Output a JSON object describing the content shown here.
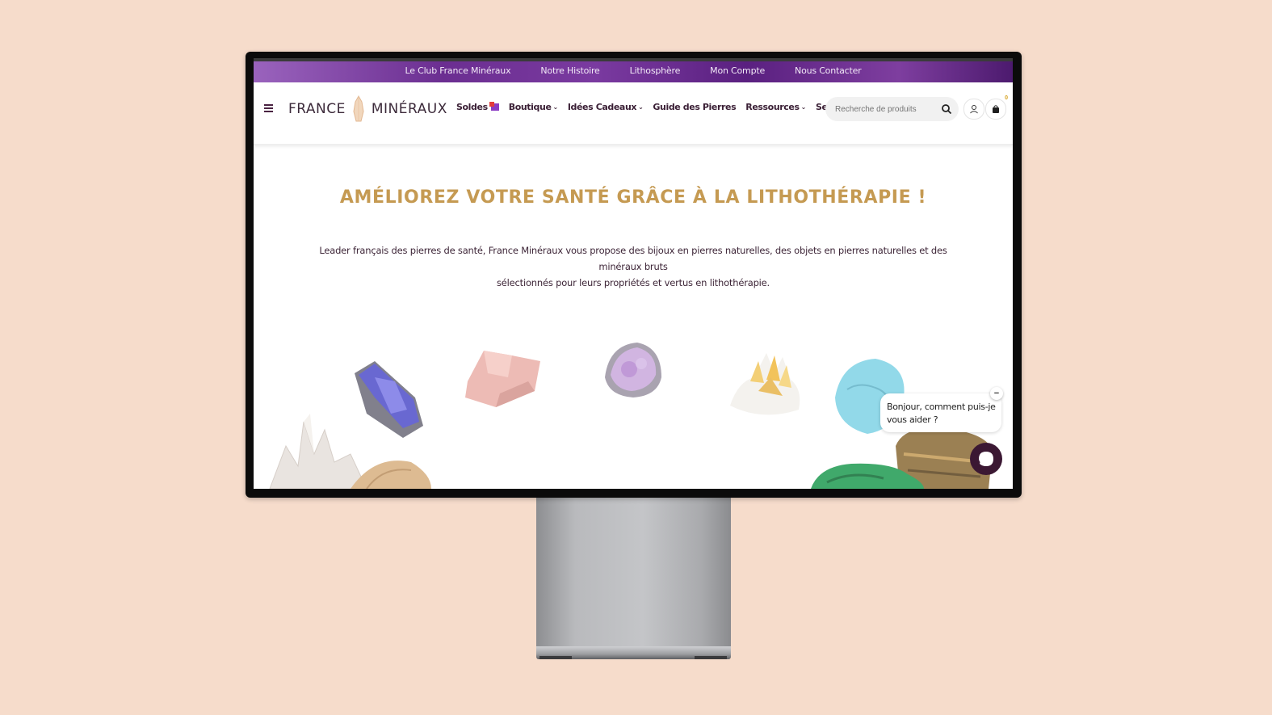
{
  "topbar": {
    "links": [
      "Le Club France Minéraux",
      "Notre Histoire",
      "Lithosphère",
      "Mon Compte",
      "Nous Contacter"
    ]
  },
  "header": {
    "logo_left": "FRANCE",
    "logo_right": "MINÉRAUX",
    "nav": {
      "soldes": "Soldes",
      "boutique": "Boutique",
      "idees": "Idées Cadeaux",
      "guide": "Guide des Pierres",
      "ressources": "Ressources",
      "services": "Services"
    },
    "search_placeholder": "Recherche de produits",
    "cart_count": "0"
  },
  "hero": {
    "title": "AMÉLIOREZ VOTRE SANTÉ GRÂCE À LA LITHOTHÉRAPIE !",
    "text_line1": "Leader français des pierres de santé, France Minéraux vous propose des bijoux en pierres naturelles, des objets en pierres naturelles et des minéraux bruts",
    "text_line2": "sélectionnés pour leurs propriétés et vertus en lithothérapie."
  },
  "chat": {
    "line1": "Bonjour, comment puis-je",
    "line2": "vous aider ?",
    "close": "−"
  },
  "colors": {
    "page_bg": "#f6dccb",
    "accent_gold": "#c59a52",
    "brand_plum": "#3b1833",
    "topbar_purple": "#6b2e91"
  }
}
